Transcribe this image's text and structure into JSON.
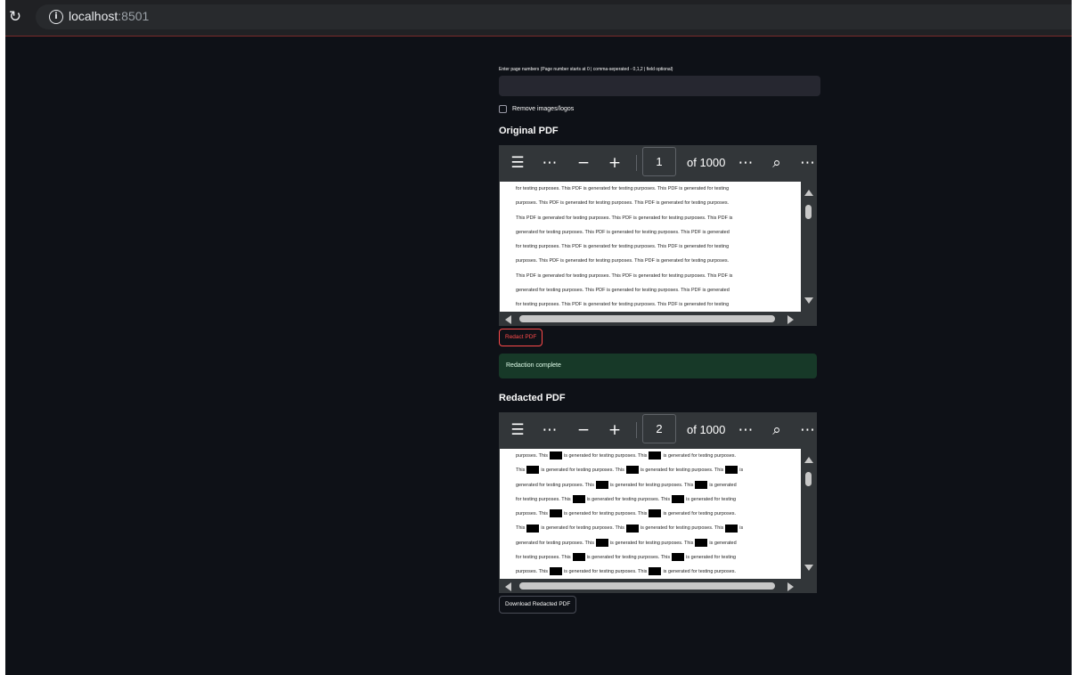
{
  "browser": {
    "url_host": "localhost",
    "url_port": ":8501"
  },
  "form": {
    "page_numbers_label": "Enter page numbers (Page number starts at 0 | comma-seperated - 0,1,2 | field optional)",
    "page_numbers_value": "",
    "remove_images_label": "Remove images/logos"
  },
  "original": {
    "title": "Original PDF",
    "current_page": "1",
    "of_pages": "of 1000",
    "lines": [
      "for testing purposes. This PDF is generated for testing purposes. This PDF is generated for testing",
      "purposes. This PDF is generated for testing purposes. This PDF is generated for testing purposes.",
      "This PDF is generated for testing purposes. This PDF is generated for testing purposes. This PDF is",
      "generated for testing purposes. This PDF is generated for testing purposes. This PDF is generated",
      "for testing purposes. This PDF is generated for testing purposes. This PDF is generated for testing",
      "purposes. This PDF is generated for testing purposes. This PDF is generated for testing purposes.",
      "This PDF is generated for testing purposes. This PDF is generated for testing purposes. This PDF is",
      "generated for testing purposes. This PDF is generated for testing purposes. This PDF is generated",
      "for testing purposes. This PDF is generated for testing purposes. This PDF is generated for testing"
    ]
  },
  "actions": {
    "redact_label": "Redact PDF",
    "success_message": "Redaction complete",
    "download_label": "Download Redacted PDF"
  },
  "redacted": {
    "title": "Redacted PDF",
    "current_page": "2",
    "of_pages": "of 1000",
    "lines": [
      [
        "purposes. This",
        "is generated for testing purposes. This",
        "is generated for testing purposes."
      ],
      [
        "This",
        "is generated for testing purposes. This",
        "is generated for testing purposes. This",
        "is"
      ],
      [
        "generated for testing purposes. This",
        "is generated for testing purposes. This",
        "is generated"
      ],
      [
        "for testing purposes. This",
        "is generated for testing purposes. This",
        "is generated for testing"
      ],
      [
        "purposes. This",
        "is generated for testing purposes. This",
        "is generated for testing purposes."
      ],
      [
        "This",
        "is generated for testing purposes. This",
        "is generated for testing purposes. This",
        "is"
      ],
      [
        "generated for testing purposes. This",
        "is generated for testing purposes. This",
        "is generated"
      ],
      [
        "for testing purposes. This",
        "is generated for testing purposes. This",
        "is generated for testing"
      ],
      [
        "purposes. This",
        "is generated for testing purposes. This",
        "is generated for testing purposes."
      ]
    ]
  },
  "toolbar_icons": [
    "outline-icon",
    "more-icon",
    "zoom-out-icon",
    "zoom-in-icon",
    "more-icon",
    "search-icon",
    "overflow-icon"
  ],
  "colors": {
    "app_bg": "#0e1117",
    "input_bg": "#262730",
    "accent": "#ff4b4b",
    "success_bg": "#173928",
    "viewer_bg": "#323639"
  }
}
